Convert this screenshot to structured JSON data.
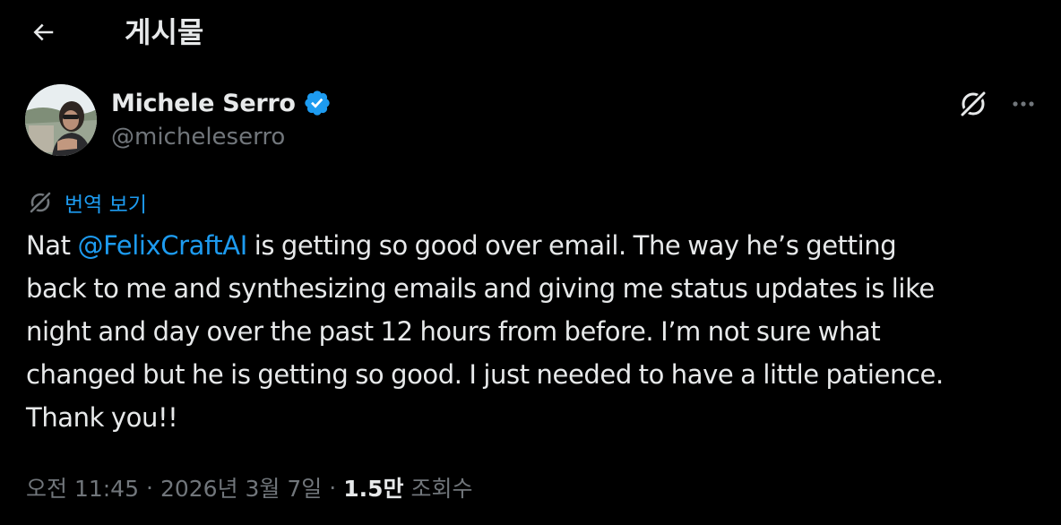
{
  "header": {
    "title": "게시물",
    "back_icon": "back-arrow-icon"
  },
  "author": {
    "name": "Michele Serro",
    "handle": "@micheleserro",
    "verified_icon": "verified-badge-icon",
    "verified_color": "#1d9bf0"
  },
  "actions": {
    "grok_icon": "grok-icon",
    "more_icon": "more-horizontal-icon"
  },
  "translate": {
    "label": "번역 보기",
    "icon": "grok-translate-icon"
  },
  "tweet": {
    "lines": [
      {
        "before": "Nat ",
        "mention": "@FelixCraftAI",
        "after": " is getting so good over email. The way he’s getting"
      },
      {
        "text": "back to me and synthesizing emails and giving me status updates is like"
      },
      {
        "text": "night and day over the past 12 hours from before. I’m not sure what"
      },
      {
        "text": "changed but he is getting so good. I just needed to have a little patience."
      },
      {
        "text": "Thank you!!"
      }
    ]
  },
  "meta": {
    "time": "오전 11:45",
    "separator": "·",
    "date": "2026년 3월 7일",
    "views_count": "1.5만",
    "views_label": "조회수"
  },
  "colors": {
    "background": "#000000",
    "text": "#e7e9ea",
    "secondary": "#71767b",
    "accent": "#1d9bf0"
  }
}
